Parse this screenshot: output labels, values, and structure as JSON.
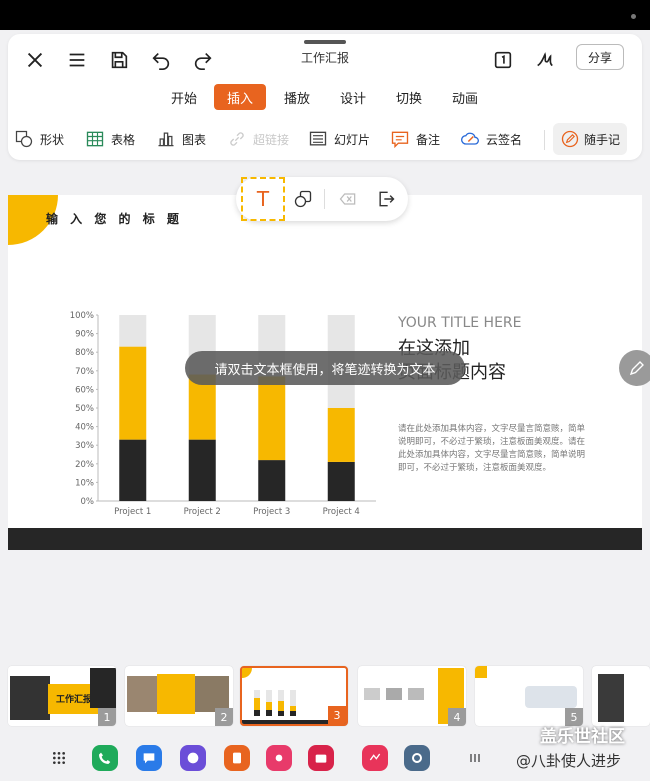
{
  "app": {
    "doc_title": "工作汇报"
  },
  "toolbar": {
    "share_label": "分享"
  },
  "tabs": [
    {
      "label": "开始",
      "active": false
    },
    {
      "label": "插入",
      "active": true
    },
    {
      "label": "播放",
      "active": false
    },
    {
      "label": "设计",
      "active": false
    },
    {
      "label": "切换",
      "active": false
    },
    {
      "label": "动画",
      "active": false
    }
  ],
  "tools": {
    "shape": "形状",
    "table": "表格",
    "chart": "图表",
    "hyperlink": "超链接",
    "slide": "幻灯片",
    "note": "备注",
    "cloud_sign": "云签名",
    "pen": "随手记"
  },
  "float_toolbar": {
    "text_glyph": "T"
  },
  "slide": {
    "title": "输 入 您 的 标 题",
    "heading_en": "YOUR TITLE HERE",
    "heading_cn": "在这添加\n页面标题内容",
    "body": "请在此处添加具体内容，文字尽量言简意赅，简单说明即可，不必过于繁琐，注意板面美观度。请在此处添加具体内容，文字尽量言简意赅，简单说明即可，不必过于繁琐，注意板面美观度。"
  },
  "toast": "请双击文本框使用，将笔迹转换为文本",
  "chart_data": {
    "type": "bar",
    "stacked": true,
    "categories": [
      "Project 1",
      "Project 2",
      "Project 3",
      "Project 4"
    ],
    "series": [
      {
        "values": [
          33,
          33,
          22,
          21
        ],
        "color": "#262626"
      },
      {
        "values": [
          50,
          35,
          45,
          29
        ],
        "color": "#f7b800"
      },
      {
        "values": [
          17,
          32,
          33,
          50
        ],
        "color": "#e6e6e6"
      }
    ],
    "ylim": [
      0,
      100
    ],
    "yticks": [
      "0%",
      "10%",
      "20%",
      "30%",
      "40%",
      "50%",
      "60%",
      "70%",
      "80%",
      "90%",
      "100%"
    ],
    "grid": false
  },
  "thumbnails": [
    {
      "num": "1",
      "title": "工作汇报",
      "active": false
    },
    {
      "num": "2",
      "active": false
    },
    {
      "num": "3",
      "active": true
    },
    {
      "num": "4",
      "active": false
    },
    {
      "num": "5",
      "active": false
    }
  ],
  "watermark": {
    "line1": "盖乐世社区",
    "line2": "@八卦使人进步"
  },
  "colors": {
    "accent": "#e8641f",
    "yellow": "#f7b800",
    "dark": "#262626"
  }
}
